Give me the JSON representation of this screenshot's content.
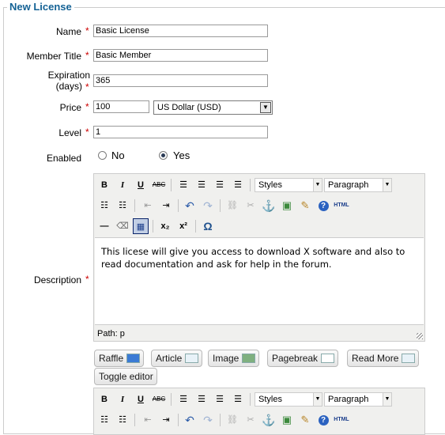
{
  "legend": "New License",
  "form": {
    "name": {
      "label": "Name",
      "value": "Basic License"
    },
    "member_title": {
      "label": "Member Title",
      "value": "Basic Member"
    },
    "expiration": {
      "label_line1": "Expiration",
      "label_line2": "(days)",
      "value": "365"
    },
    "price": {
      "label": "Price",
      "value": "100",
      "currency": "US Dollar (USD)"
    },
    "level": {
      "label": "Level",
      "value": "1"
    },
    "enabled": {
      "label": "Enabled",
      "options": [
        "No",
        "Yes"
      ],
      "selected": "Yes"
    },
    "description": {
      "label": "Description"
    },
    "required_mark": "*"
  },
  "editor": {
    "styles_select": "Styles",
    "format_select": "Paragraph",
    "content": "This licese will give you access to download X software and also to read documentation and ask for help in the forum.",
    "path": "Path: p",
    "html_label": "HTML",
    "omega_label": "Ω"
  },
  "extra_buttons": [
    "Raffle",
    "Article",
    "Image",
    "Pagebreak",
    "Read More"
  ],
  "toggle_editor": "Toggle editor"
}
